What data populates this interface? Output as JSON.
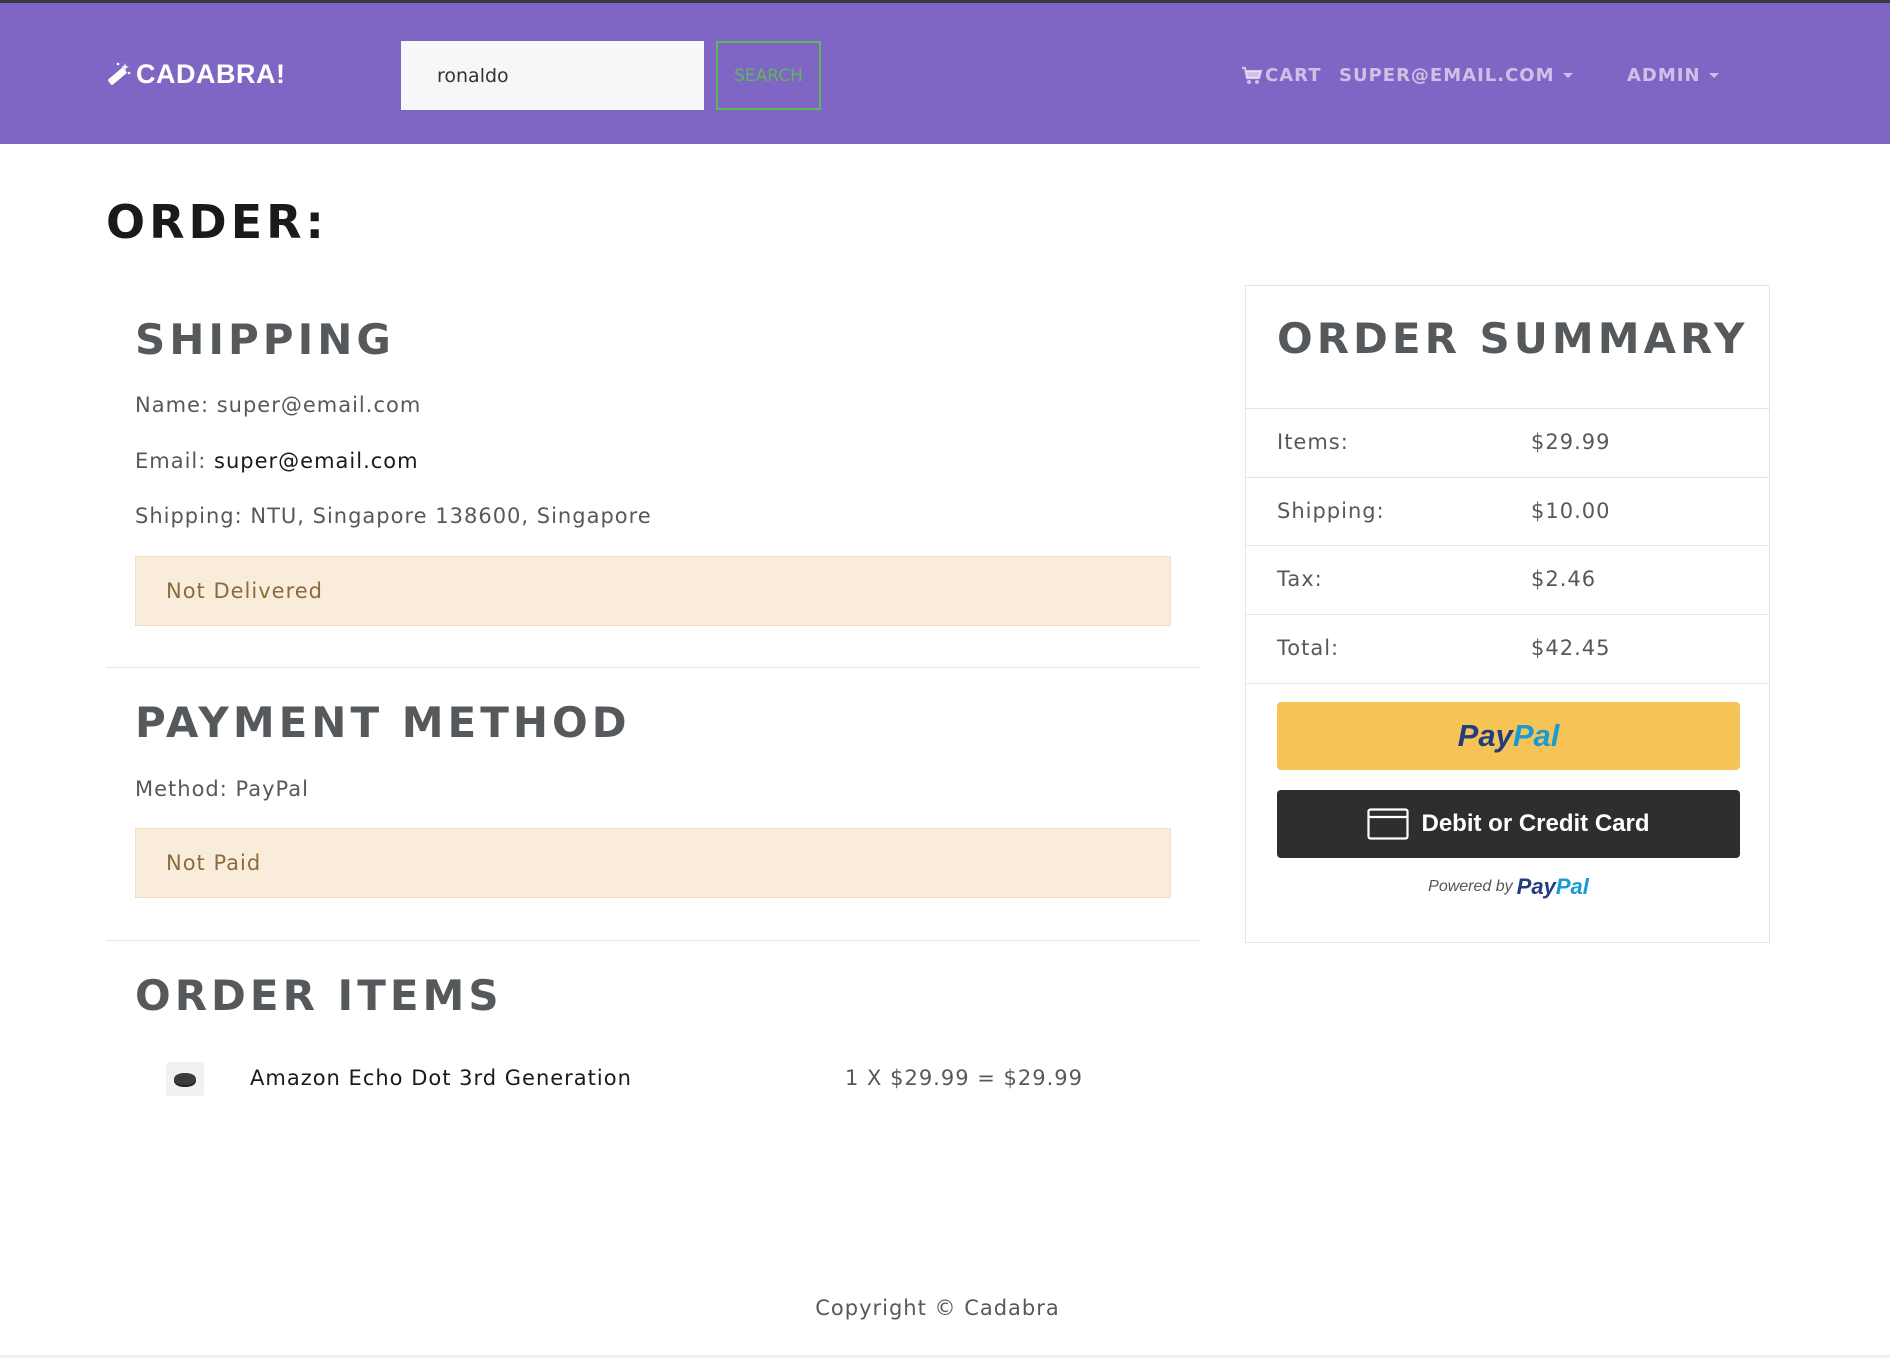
{
  "navbar": {
    "brand": "CADABRA!",
    "search_value": "ronaldo",
    "search_button": "SEARCH",
    "cart_label": "CART",
    "user_label": "SUPER@EMAIL.COM",
    "admin_label": "ADMIN"
  },
  "page": {
    "title": "ORDER:"
  },
  "shipping": {
    "heading": "SHIPPING",
    "name_label": "Name:",
    "name_value": "super@email.com",
    "email_label": "Email:",
    "email_value": "super@email.com",
    "address_label": "Shipping:",
    "address_value": "NTU, Singapore 138600, Singapore",
    "status": "Not Delivered"
  },
  "payment": {
    "heading": "PAYMENT METHOD",
    "method_label": "Method:",
    "method_value": "PayPal",
    "status": "Not Paid"
  },
  "order_items": {
    "heading": "ORDER ITEMS",
    "items": [
      {
        "name": "Amazon Echo Dot 3rd Generation",
        "calc": "1 X $29.99 = $29.99"
      }
    ]
  },
  "summary": {
    "heading": "ORDER SUMMARY",
    "rows": [
      {
        "label": "Items:",
        "value": "$29.99"
      },
      {
        "label": "Shipping:",
        "value": "$10.00"
      },
      {
        "label": "Tax:",
        "value": "$2.46"
      },
      {
        "label": "Total:",
        "value": "$42.45"
      }
    ],
    "paypal_pay": "Pay",
    "paypal_pal": "Pal",
    "card_button": "Debit or Credit Card",
    "powered_by": "Powered by"
  },
  "footer": {
    "copyright": "Copyright © Cadabra"
  },
  "colors": {
    "navbar": "#8066c4",
    "search_green": "#5cb85c",
    "alert_bg": "#faecdb",
    "paypal_yellow": "#f6c456",
    "card_dark": "#2c2e2f"
  }
}
